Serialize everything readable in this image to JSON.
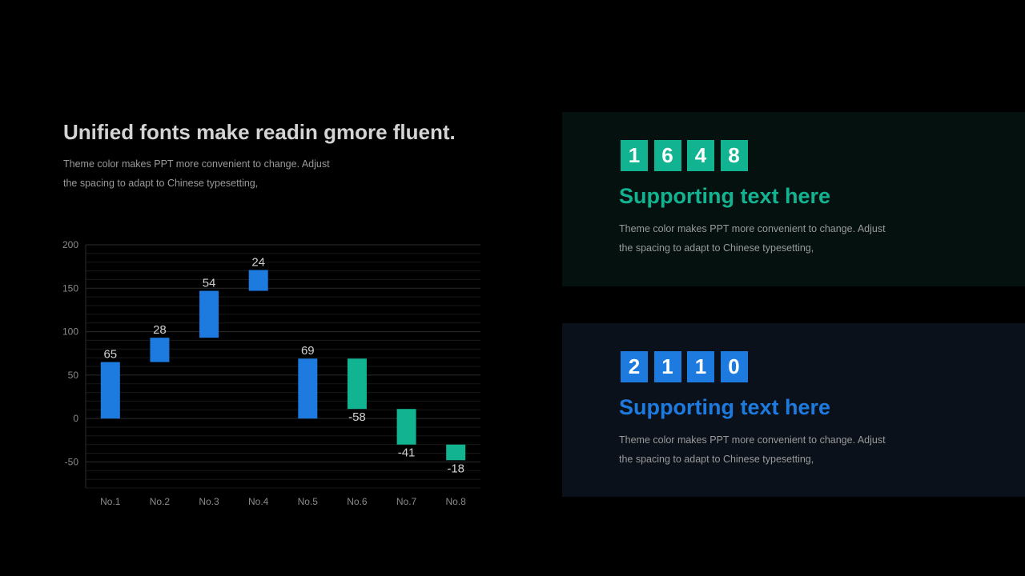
{
  "left": {
    "title": "Unified fonts make readin gmore fluent.",
    "body_line1": "Theme color makes PPT more convenient to change. Adjust",
    "body_line2": "the spacing to adapt to Chinese typesetting,"
  },
  "cards": [
    {
      "digits": [
        "1",
        "6",
        "4",
        "8"
      ],
      "heading": "Supporting text here",
      "body_line1": "Theme color makes PPT more convenient to change. Adjust",
      "body_line2": "the spacing to adapt to Chinese typesetting,"
    },
    {
      "digits": [
        "2",
        "1",
        "1",
        "0"
      ],
      "heading": "Supporting text here",
      "body_line1": "Theme color makes PPT more convenient to change. Adjust",
      "body_line2": "the spacing to adapt to Chinese typesetting,"
    }
  ],
  "colors": {
    "background": "#000000",
    "increase": "#1d7be0",
    "decrease": "#12b391",
    "text_muted": "#9a9a9a",
    "title": "#d4d4d4"
  },
  "chart_data": {
    "type": "bar",
    "subtype": "waterfall",
    "title": "",
    "xlabel": "",
    "ylabel": "",
    "categories": [
      "No.1",
      "No.2",
      "No.3",
      "No.4",
      "No.5",
      "No.6",
      "No.7",
      "No.8"
    ],
    "changes": [
      65,
      28,
      54,
      24,
      69,
      -58,
      -41,
      -18
    ],
    "bar_start": [
      0,
      65,
      93,
      147,
      0,
      69,
      11,
      -30
    ],
    "bar_end": [
      65,
      93,
      147,
      171,
      69,
      11,
      -30,
      -48
    ],
    "labels": [
      "65",
      "28",
      "54",
      "24",
      "69",
      "-58",
      "-41",
      "-18"
    ],
    "ylim": [
      -80,
      200
    ],
    "yticks": [
      200,
      150,
      100,
      50,
      0,
      -50
    ],
    "grid": true,
    "legend": "none"
  }
}
